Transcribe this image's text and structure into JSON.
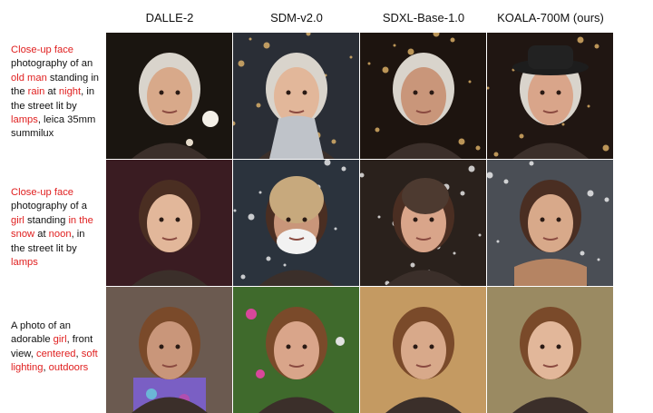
{
  "columns": [
    "DALLE-2",
    "SDM-v2.0",
    "SDXL-Base-1.0",
    "KOALA-700M (ours)"
  ],
  "rows": [
    {
      "prompt_segments": [
        {
          "text": "Close-up face",
          "highlight": true
        },
        {
          "text": " photography of an ",
          "highlight": false
        },
        {
          "text": "old man",
          "highlight": true
        },
        {
          "text": " standing in the ",
          "highlight": false
        },
        {
          "text": "rain",
          "highlight": true
        },
        {
          "text": " at ",
          "highlight": false
        },
        {
          "text": "night",
          "highlight": true
        },
        {
          "text": ", in the street lit by ",
          "highlight": false
        },
        {
          "text": "lamps",
          "highlight": true
        },
        {
          "text": ", leica 35mm summilux",
          "highlight": false
        }
      ],
      "images": [
        {
          "label": "old-man-night-rain",
          "bg": "#1a1510",
          "subject": "old-man"
        },
        {
          "label": "old-man-snow-night",
          "bg": "#2a2e36",
          "subject": "old-man-coat"
        },
        {
          "label": "old-man-street-lamps",
          "bg": "#1d140f",
          "subject": "old-man"
        },
        {
          "label": "old-man-hat-street",
          "bg": "#201612",
          "subject": "old-man-hat"
        }
      ]
    },
    {
      "prompt_segments": [
        {
          "text": "Close-up face",
          "highlight": true
        },
        {
          "text": " photography of a ",
          "highlight": false
        },
        {
          "text": "girl",
          "highlight": true
        },
        {
          "text": " standing ",
          "highlight": false
        },
        {
          "text": "in the snow",
          "highlight": true
        },
        {
          "text": " at ",
          "highlight": false
        },
        {
          "text": "noon",
          "highlight": true
        },
        {
          "text": ", in the street lit by ",
          "highlight": false
        },
        {
          "text": "lamps",
          "highlight": true
        }
      ],
      "images": [
        {
          "label": "girl-warm-light",
          "bg": "#3a1c22",
          "subject": "girl-dark"
        },
        {
          "label": "girl-snow-mask",
          "bg": "#2b333d",
          "subject": "girl-knit"
        },
        {
          "label": "girl-street-bokeh",
          "bg": "#2a211c",
          "subject": "girl-beanie"
        },
        {
          "label": "girl-snow-scarf",
          "bg": "#4a4e55",
          "subject": "girl-scarf"
        }
      ]
    },
    {
      "prompt_segments": [
        {
          "text": "A photo of an adorable ",
          "highlight": false
        },
        {
          "text": "girl",
          "highlight": true
        },
        {
          "text": ", front view, ",
          "highlight": false
        },
        {
          "text": "centered",
          "highlight": true
        },
        {
          "text": ", ",
          "highlight": false
        },
        {
          "text": "soft lighting",
          "highlight": true
        },
        {
          "text": ", ",
          "highlight": false
        },
        {
          "text": "outdoors",
          "highlight": true
        }
      ],
      "images": [
        {
          "label": "child-floral-dress",
          "bg": "#6b5a50",
          "subject": "child"
        },
        {
          "label": "toddler-garden",
          "bg": "#3f6a2c",
          "subject": "toddler"
        },
        {
          "label": "girl-golden-hour",
          "bg": "#c49a62",
          "subject": "child-warm"
        },
        {
          "label": "girl-braids-outdoor",
          "bg": "#9a8a62",
          "subject": "child-braids"
        }
      ]
    }
  ],
  "colors": {
    "highlight": "#e02020",
    "text": "#111111"
  }
}
